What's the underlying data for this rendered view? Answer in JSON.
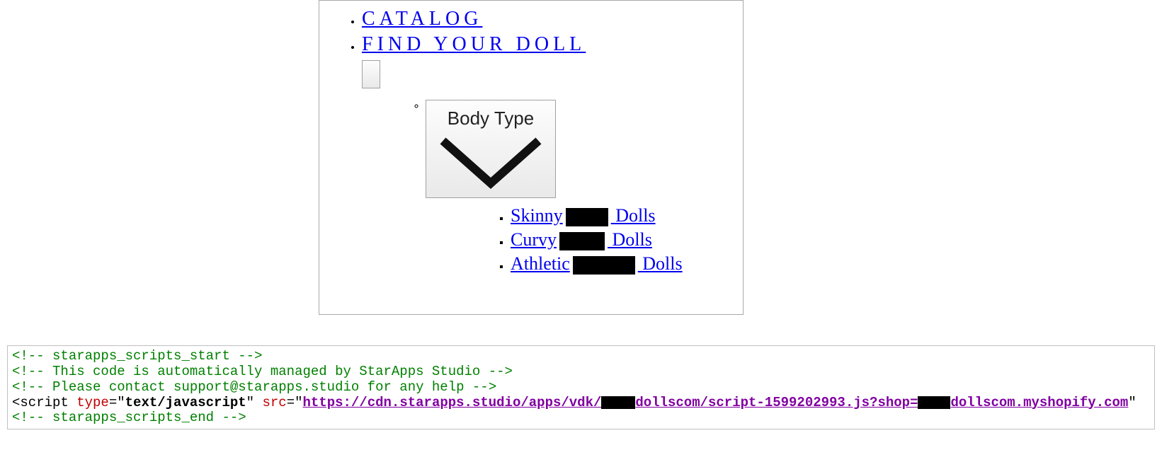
{
  "nav": {
    "items": [
      {
        "label": "CATALOG"
      },
      {
        "label": "FIND YOUR DOLL"
      }
    ],
    "bodytype_label": "Body Type",
    "sub": {
      "a_pre": "Skinny",
      "a_post": " Dolls",
      "b_pre": "Curvy",
      "b_post": " Dolls",
      "c_pre": "Athletic",
      "c_post": " Dolls"
    }
  },
  "code": {
    "c1": "<!-- starapps_scripts_start -->",
    "c2": "<!-- This code is automatically managed by StarApps Studio -->",
    "c3": "<!-- Please contact support@starapps.studio for any help -->",
    "tag_open": "<script ",
    "attr_type": "type",
    "val_type": "text/javascript",
    "attr_src": "src",
    "url_a": "https://cdn.starapps.studio/apps/vdk/",
    "url_b": "dollscom/script-1599202993.js?shop=",
    "url_c": "dollscom.myshopify.com",
    "c4": "<!-- starapps_scripts_end -->"
  }
}
